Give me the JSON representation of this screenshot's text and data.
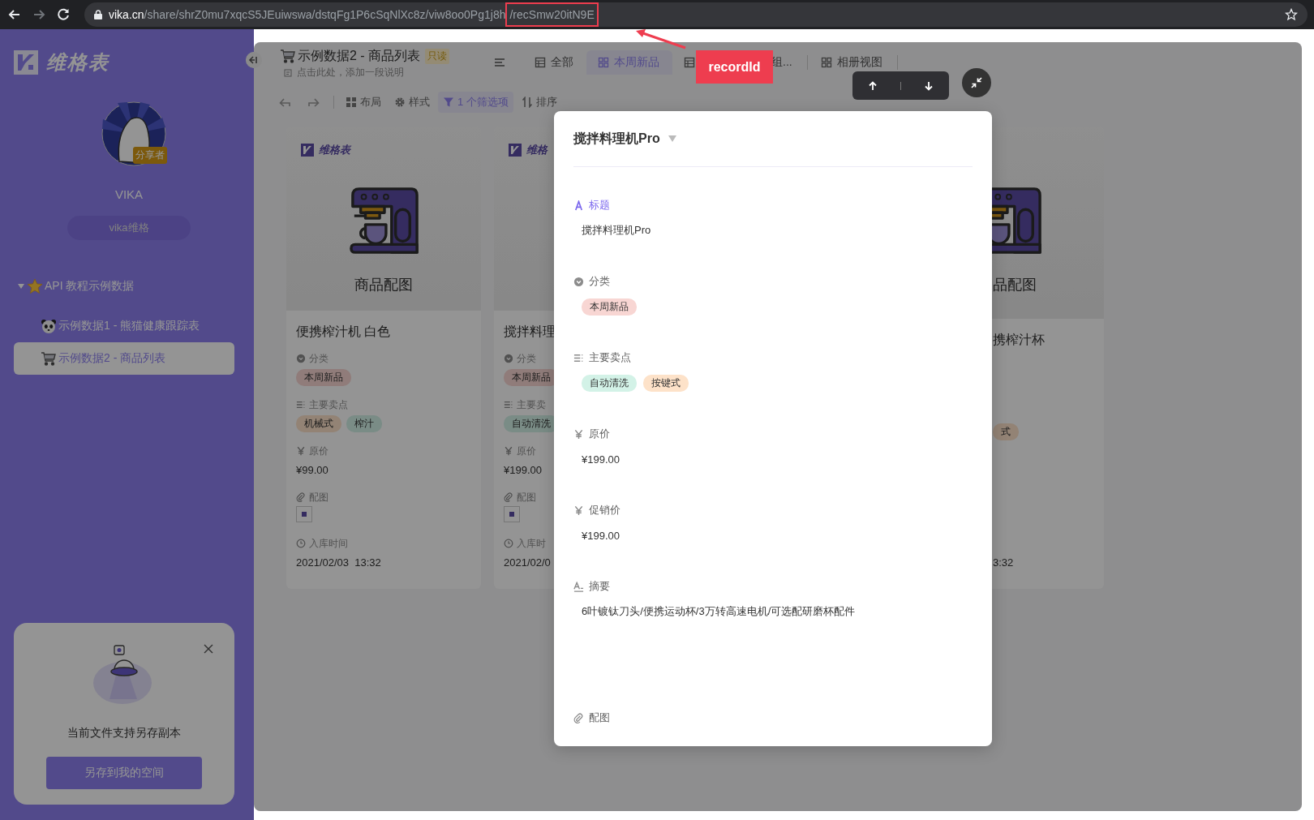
{
  "browser": {
    "url_host": "vika.cn",
    "url_path": "/share/shrZ0mu7xqcS5JEuiwswa/dstqFg1P6cSqNlXc8z/viw8oo0Pg1j8h",
    "url_highlight": "/recSmw20itN9E"
  },
  "annotation": {
    "label": "recordId"
  },
  "sidebar": {
    "brand": "维格表",
    "user": {
      "badge": "分享者",
      "name": "VIKA",
      "space": "vika维格"
    },
    "tree": [
      {
        "label": "API 教程示例数据",
        "kind": "star",
        "expanded": true,
        "children": [
          {
            "label": "示例数据1 - 熊猫健康跟踪表",
            "kind": "panda",
            "selected": false
          },
          {
            "label": "示例数据2 - 商品列表",
            "kind": "cart",
            "selected": true
          }
        ]
      }
    ],
    "promo": {
      "text": "当前文件支持另存副本",
      "button": "另存到我的空间"
    }
  },
  "header": {
    "title": "示例数据2 - 商品列表",
    "badge": "只读",
    "description_placeholder": "点击此处，添加一段说明",
    "views": [
      {
        "label": "全部",
        "kind": "grid",
        "selected": false
      },
      {
        "label": "本周新品",
        "kind": "gallery",
        "selected": true
      },
      {
        "label": "组...",
        "kind": "grid",
        "selected": false
      },
      {
        "label": "相册视图",
        "kind": "gallery",
        "selected": false
      }
    ]
  },
  "toolbar": [
    {
      "label": "布局",
      "kind": "layout",
      "active": false
    },
    {
      "label": "样式",
      "kind": "style",
      "active": false
    },
    {
      "label": "1 个筛选项",
      "kind": "filter",
      "active": true
    },
    {
      "label": "排序",
      "kind": "sort",
      "active": false
    }
  ],
  "cards": [
    {
      "clipped": false,
      "cover": {
        "logo": "维格表",
        "caption": "商品配图"
      },
      "title": "便携榨汁机 白色",
      "fields": [
        {
          "label": "分类",
          "kind": "select",
          "tags": [
            {
              "label": "本周新品",
              "color": "#907c7a"
            }
          ]
        },
        {
          "label": "主要卖点",
          "kind": "multi",
          "tags": [
            {
              "label": "机械式",
              "color": "#938375"
            },
            {
              "label": "榨汁",
              "color": "#7a8c86"
            }
          ]
        },
        {
          "label": "原价",
          "kind": "currency",
          "value": "¥99.00"
        },
        {
          "label": "配图",
          "kind": "attachment"
        },
        {
          "label": "入库时间",
          "kind": "datetime",
          "value": "2021/02/03  13:32"
        }
      ]
    },
    {
      "clipped": false,
      "cover": {
        "logo": "维格"
      },
      "title": "搅拌料理",
      "fields": [
        {
          "label": "分类",
          "kind": "select",
          "tags": [
            {
              "label": "本周新品",
              "color": "#907c7a"
            }
          ]
        },
        {
          "label": "主要卖",
          "kind": "multi",
          "tags": [
            {
              "label": "自动清洗",
              "color": "#7a8c86"
            }
          ]
        },
        {
          "label": "原价",
          "kind": "currency",
          "value": "¥199.00"
        },
        {
          "label": "配图",
          "kind": "attachment"
        },
        {
          "label": "入库时",
          "kind": "datetime",
          "value": "2021/02/0"
        }
      ]
    },
    {
      "clipped": true,
      "cover": {
        "caption": "品配图"
      },
      "title": "携榨汁杯",
      "fields": [
        {
          "kind": "multi",
          "tags": [
            {
              "label": "式",
              "color": "#938375"
            }
          ]
        },
        {
          "kind": "datetime",
          "value": "3:32"
        }
      ]
    }
  ],
  "record": {
    "title": "搅拌料理机Pro",
    "fields": [
      {
        "label": "标题",
        "kind": "text",
        "primary": true,
        "value": "搅拌料理机Pro"
      },
      {
        "label": "分类",
        "kind": "select",
        "primary": false,
        "tags": [
          {
            "label": "本周新品",
            "color": "#f8d6d3"
          }
        ]
      },
      {
        "label": "主要卖点",
        "kind": "multi",
        "primary": false,
        "tags": [
          {
            "label": "自动清洗",
            "color": "#d3f2e7"
          },
          {
            "label": "按键式",
            "color": "#fde2c9"
          }
        ]
      },
      {
        "label": "原价",
        "kind": "currency",
        "primary": false,
        "value": "¥199.00"
      },
      {
        "label": "促销价",
        "kind": "currency",
        "primary": false,
        "value": "¥199.00"
      },
      {
        "label": "摘要",
        "kind": "long_text",
        "primary": false,
        "value": "6叶镀钛刀头/便携运动杯/3万转高速电机/可选配研磨杯配件"
      },
      {
        "label": "配图",
        "kind": "attachment",
        "primary": false
      }
    ]
  }
}
